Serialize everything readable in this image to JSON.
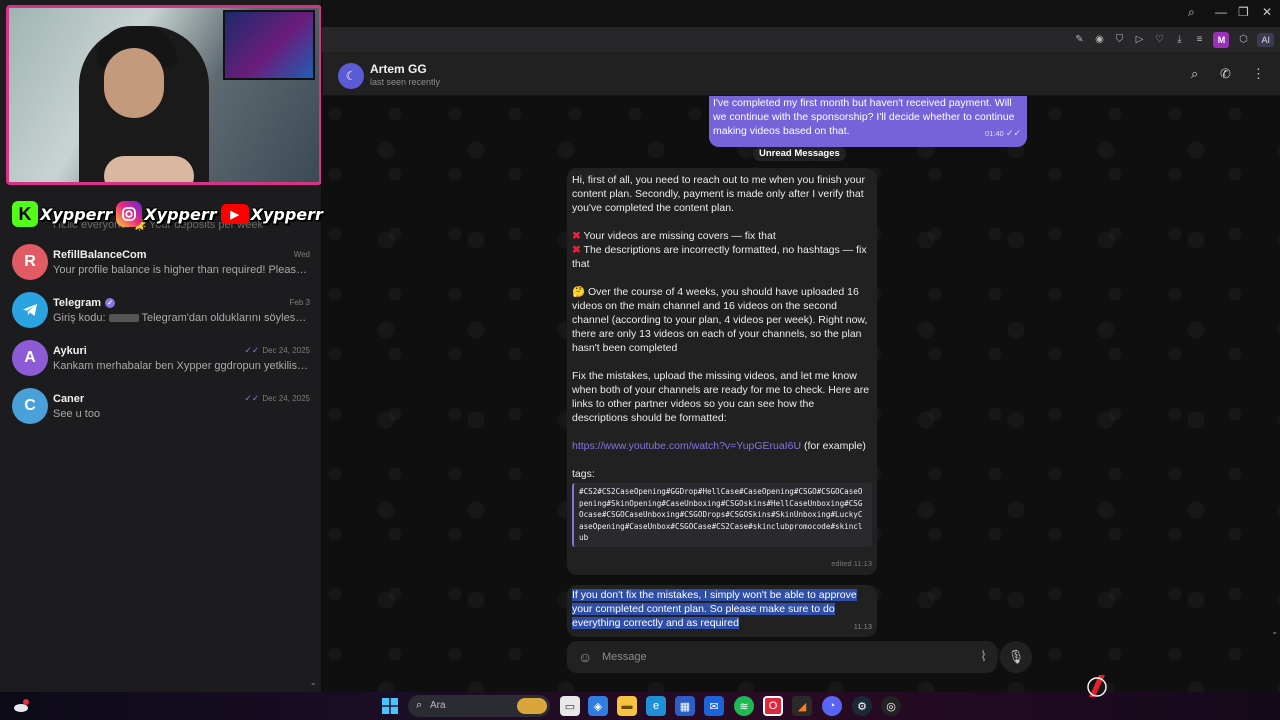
{
  "overlay": {
    "socials": [
      {
        "platform": "kick",
        "icon": "kick-icon",
        "name": "Xypperr"
      },
      {
        "platform": "instagram",
        "icon": "instagram-icon",
        "name": "Xypperr"
      },
      {
        "platform": "youtube",
        "icon": "youtube-icon",
        "name": "Xypperr"
      }
    ]
  },
  "sidebar": {
    "partial_item": {
      "preview": "Hello everyone! 🌟 Your deposits per week"
    },
    "chats": [
      {
        "initial": "R",
        "color": "#e15b64",
        "name": "RefillBalanceCom",
        "verified": false,
        "date": "Wed",
        "read": false,
        "preview": "Your profile balance is higher than required! Please ..."
      },
      {
        "initial": "",
        "color": "#2aa3e0",
        "name": "Telegram",
        "verified": true,
        "date": "Feb 3",
        "read": false,
        "preview_before": "Giriş kodu:",
        "preview_after": "Telegram'dan olduklarını söylesel..."
      },
      {
        "initial": "A",
        "color": "#8e5bd6",
        "name": "Aykuri",
        "verified": false,
        "date": "Dec 24, 2025",
        "read": true,
        "preview": "Kankam merhabalar ben Xypper ggdropun yetkilisi ..."
      },
      {
        "initial": "C",
        "color": "#4aa0d8",
        "name": "Caner",
        "verified": false,
        "date": "Dec 24, 2025",
        "read": true,
        "preview": "See u too"
      }
    ]
  },
  "browser": {
    "ai_label": "AI",
    "profile_initial": "M"
  },
  "chat": {
    "name": "Artem GG",
    "status": "last seen recently",
    "avatar_icon": "ggdrop-logo-icon",
    "outgoing": {
      "text": "I've completed my first month but haven't received payment. Will we continue with the sponsorship? I'll decide whether to continue making videos based on that.",
      "time": "01:40"
    },
    "unread_label": "Unread Messages",
    "incoming": {
      "p1": "Hi, first of all, you need to reach out to me when you finish your content plan. Secondly, payment is made only after I verify that you've completed the content plan.",
      "issue1": "Your videos are missing covers — fix that",
      "issue2": "The descriptions are incorrectly formatted, no hashtags — fix that",
      "p3": "🤔 Over the course of 4 weeks, you should have uploaded 16 videos on the main channel and 16 videos on the second channel (according to your plan, 4 videos per week). Right now, there are only 13 videos on each of your channels, so the plan hasn't been completed",
      "p4": "Fix the mistakes, upload the missing videos, and let me know when both of your channels are ready for me to check. Here are links to other partner videos so you can see how the descriptions should be formatted:",
      "link": "https://www.youtube.com/watch?v=YupGEruaI6U",
      "link_suffix": " (for example)",
      "tags_label": "tags:",
      "tags": "#CS2#CS2CaseOpening#GGDrop#HellCase#CaseOpening#CSGO#CSGOCaseOpening#SkinOpening#CaseUnboxing#CSGOskins#HellCaseUnboxing#CSGOcase#CSGOCaseUnboxing#CSGODrops#CSGOSkins#SkinUnboxing#LuckyCaseOpening#CaseUnbox#CSGOCase#CS2Case#skinclubpromocode#skinclub",
      "edited": "edited 11:13"
    },
    "last": {
      "text": "If you don't fix the mistakes, I simply won't be able to approve your completed content plan. So please make sure to do everything correctly and as required",
      "time": "11:13"
    },
    "composer": {
      "placeholder": "Message"
    }
  },
  "taskbar": {
    "search_label": "Ara"
  }
}
